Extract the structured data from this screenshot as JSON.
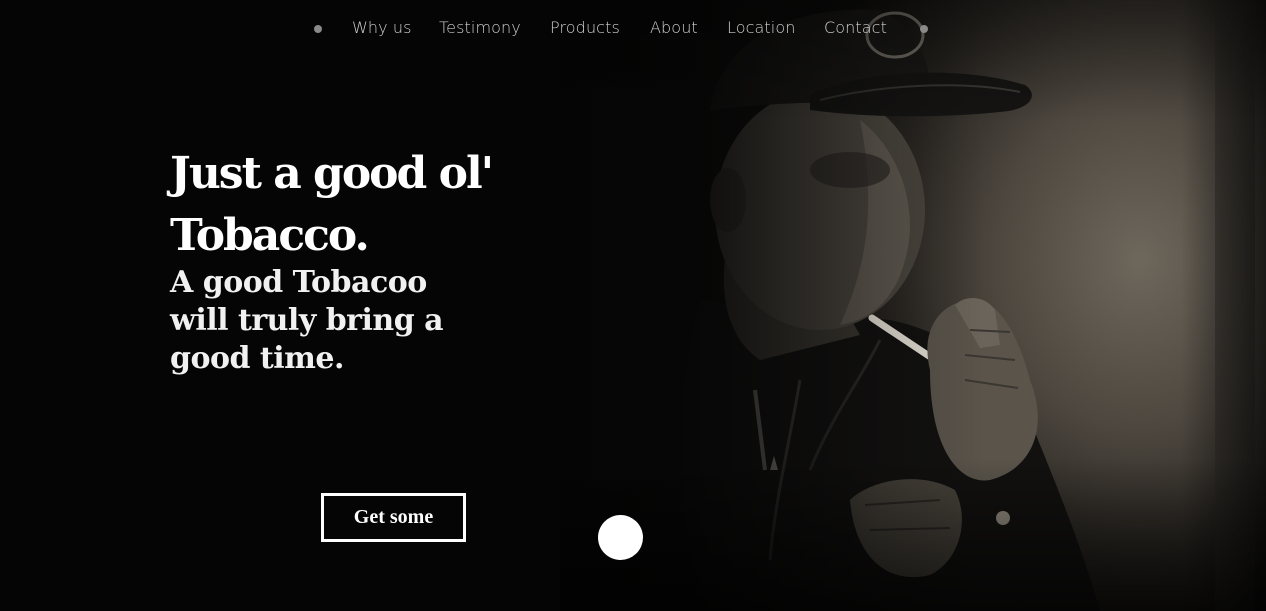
{
  "nav": {
    "items": [
      {
        "label": "Why us"
      },
      {
        "label": "Testimony"
      },
      {
        "label": "Products"
      },
      {
        "label": "About"
      },
      {
        "label": "Location"
      },
      {
        "label": "Contact"
      }
    ]
  },
  "hero": {
    "headline": "Just a good ol' Tobacco.",
    "subline": "A good Tobacoo will truly bring a good time.",
    "cta_label": "Get some"
  },
  "theme": {
    "background": "#050505",
    "text": "#ffffff",
    "nav_text": "#cfcfcf"
  }
}
